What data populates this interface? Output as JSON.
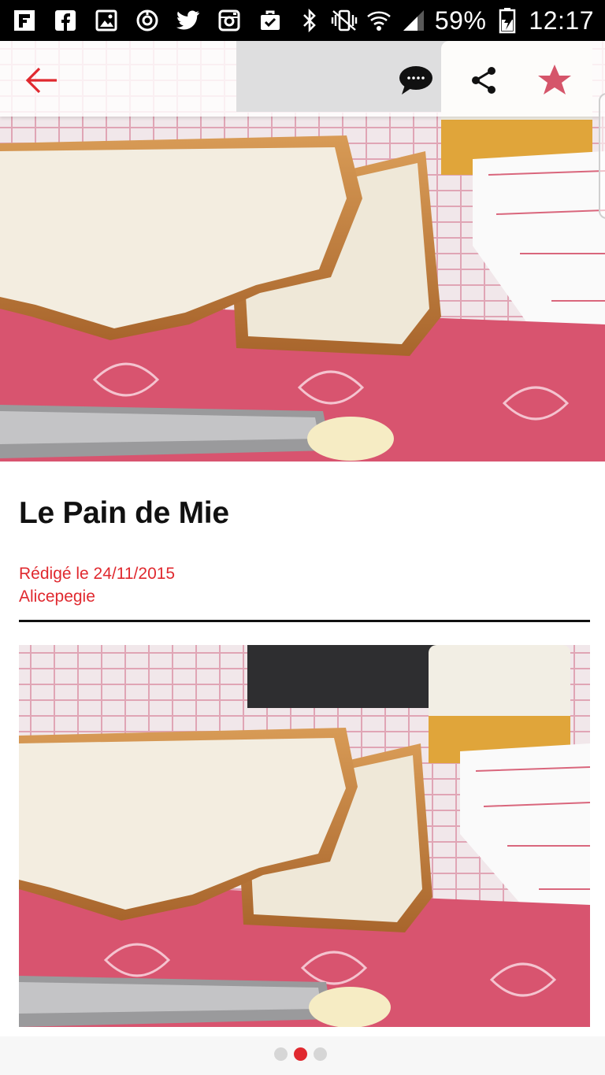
{
  "status_bar": {
    "left_icons": [
      "flipboard-icon",
      "facebook-icon",
      "gallery-icon",
      "sync-icon",
      "twitter-icon",
      "instagram-icon",
      "briefcase-icon"
    ],
    "right_icons": [
      "bluetooth-icon",
      "vibrate-icon",
      "wifi-icon",
      "signal-icon"
    ],
    "battery_percent": "59%",
    "battery_level": 0.59,
    "time": "12:17"
  },
  "toolbar": {
    "back_icon": "arrow-left-icon",
    "comment_icon": "chat-bubble-icon",
    "share_icon": "share-icon",
    "favorite_icon": "star-icon"
  },
  "colors": {
    "accent": "#e0292f",
    "status_bar": "#000000",
    "text": "#111111",
    "dot_inactive": "#d6d6d6"
  },
  "article": {
    "title": "Le Pain de Mie",
    "date_line": "Rédigé le 24/11/2015",
    "author": "Alicepegie"
  },
  "pager": {
    "page_count": 3,
    "current_page": 2
  }
}
